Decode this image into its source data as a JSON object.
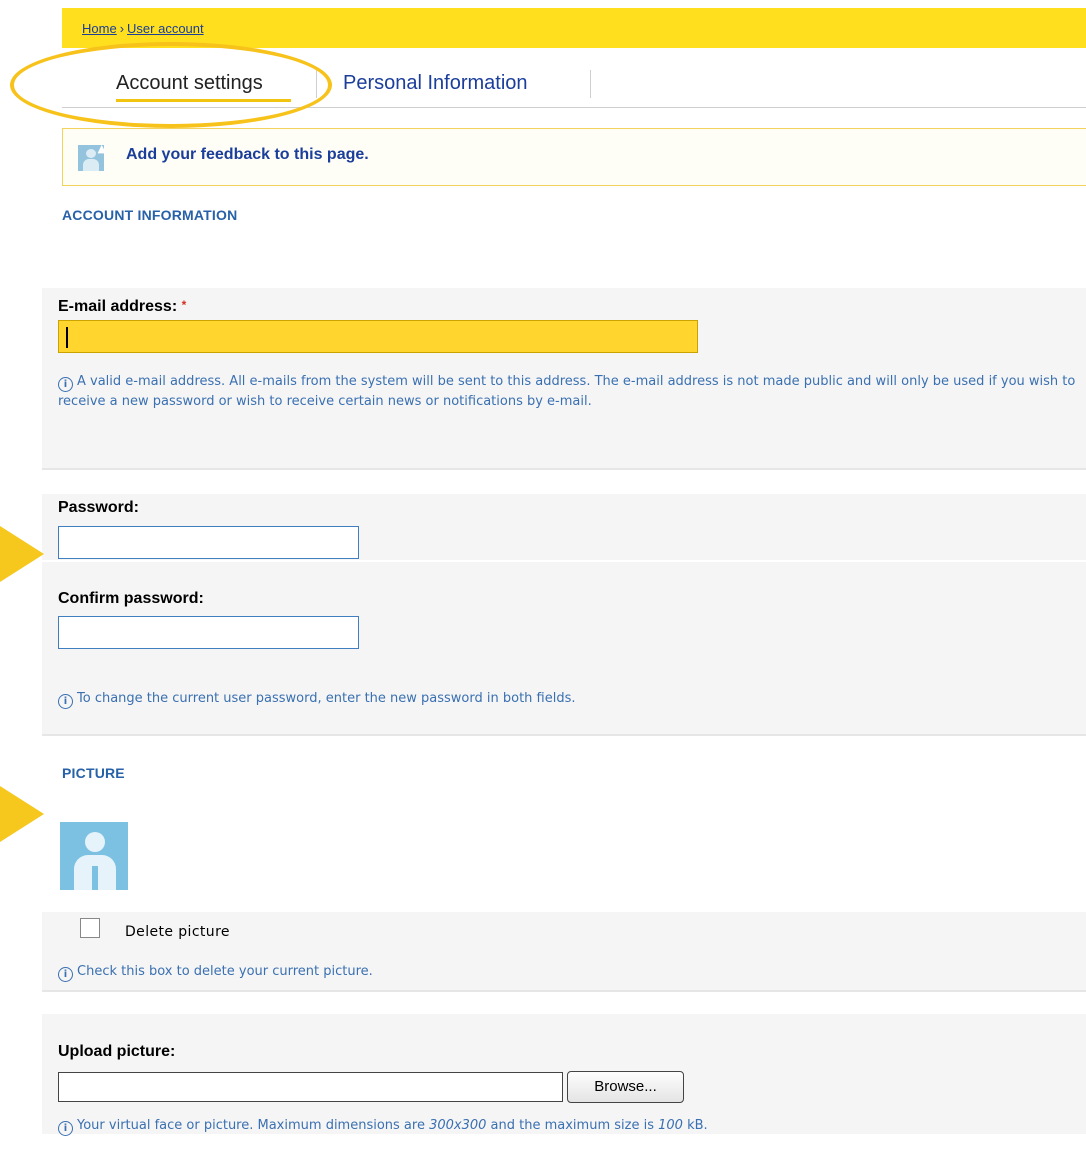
{
  "breadcrumb": {
    "home": "Home",
    "separator": "›",
    "current": "User account"
  },
  "tabs": [
    {
      "label": "Account settings",
      "active": true
    },
    {
      "label": "Personal Information",
      "active": false
    }
  ],
  "feedback": {
    "text": "Add your feedback to this page."
  },
  "account_section": {
    "title": "ACCOUNT INFORMATION",
    "email": {
      "label": "E-mail address:",
      "required_mark": "*",
      "value": "",
      "help": "A valid e-mail address. All e-mails from the system will be sent to this address. The e-mail address is not made public and will only be used if you wish to receive a new password or wish to receive certain news or notifications by e-mail."
    },
    "password": {
      "label": "Password:",
      "value": ""
    },
    "confirm_password": {
      "label": "Confirm password:",
      "value": ""
    },
    "password_help": "To change the current user password, enter the new password in both fields."
  },
  "picture_section": {
    "title": "PICTURE",
    "delete_label": "Delete picture",
    "delete_checked": false,
    "delete_help": "Check this box to delete your current picture.",
    "upload_label": "Upload picture:",
    "browse_label": "Browse...",
    "upload_help_prefix": "Your virtual face or picture. Maximum dimensions are ",
    "max_dimensions": "300x300",
    "upload_help_middle": " and the maximum size is ",
    "max_size": "100",
    "upload_help_suffix": " kB."
  },
  "info_glyph": "i",
  "colors": {
    "highlight_yellow": "#ffdf1e",
    "annotation_yellow": "#f6c71d",
    "link_blue": "#1b3e9b",
    "help_blue": "#3a70b1"
  }
}
